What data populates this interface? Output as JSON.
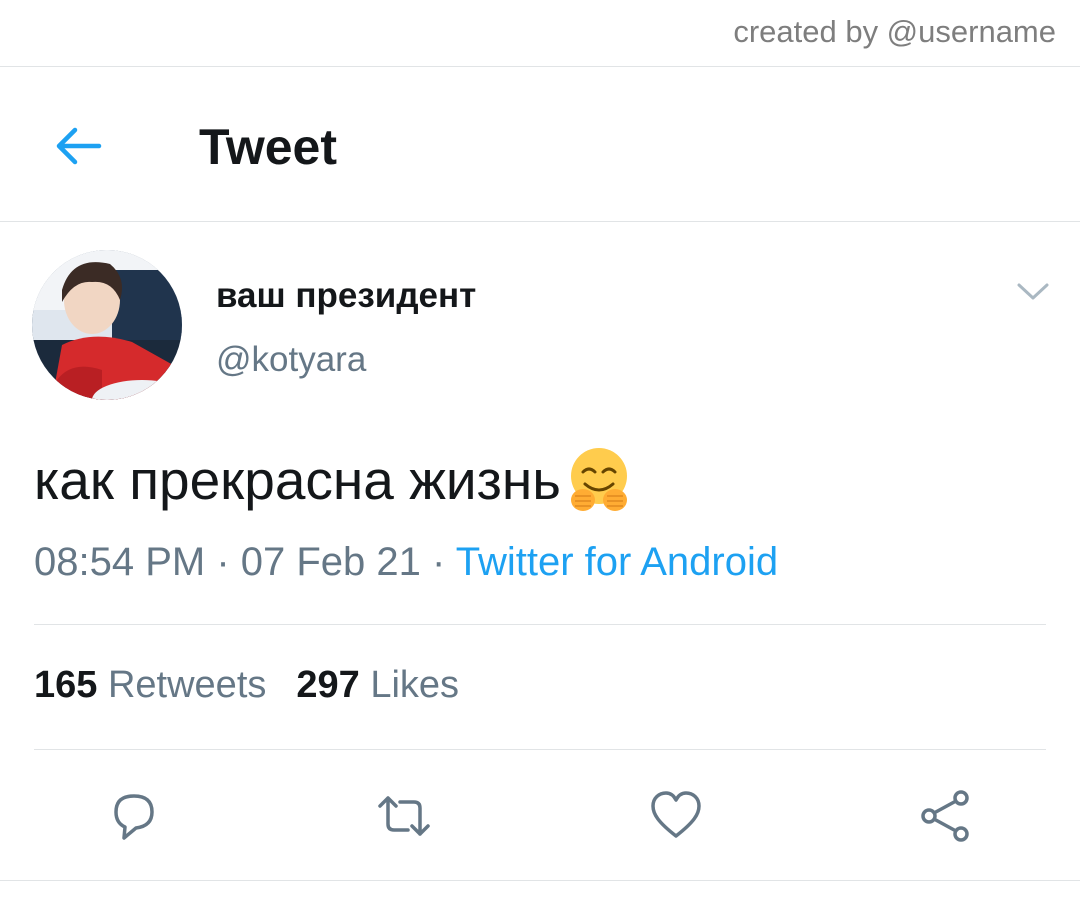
{
  "watermark": "created by @username",
  "header": {
    "title": "Tweet",
    "back_icon": "arrow-left-icon"
  },
  "colors": {
    "accent": "#1da1f2",
    "muted": "#657786",
    "text": "#14171a",
    "divider": "#e1e4e6"
  },
  "author": {
    "display_name": "ваш президент",
    "handle": "@kotyara",
    "menu_icon": "chevron-down-icon"
  },
  "tweet": {
    "text": "как прекрасна жизнь",
    "emoji": "hugging-face-emoji",
    "time": "08:54 PM",
    "date": "07 Feb 21",
    "separator": " · ",
    "source": "Twitter for Android"
  },
  "stats": {
    "retweets_count": "165",
    "retweets_label": "Retweets",
    "likes_count": "297",
    "likes_label": "Likes"
  },
  "actions": [
    {
      "name": "reply",
      "icon": "reply-icon"
    },
    {
      "name": "retweet",
      "icon": "retweet-icon"
    },
    {
      "name": "like",
      "icon": "heart-icon"
    },
    {
      "name": "share",
      "icon": "share-icon"
    }
  ]
}
